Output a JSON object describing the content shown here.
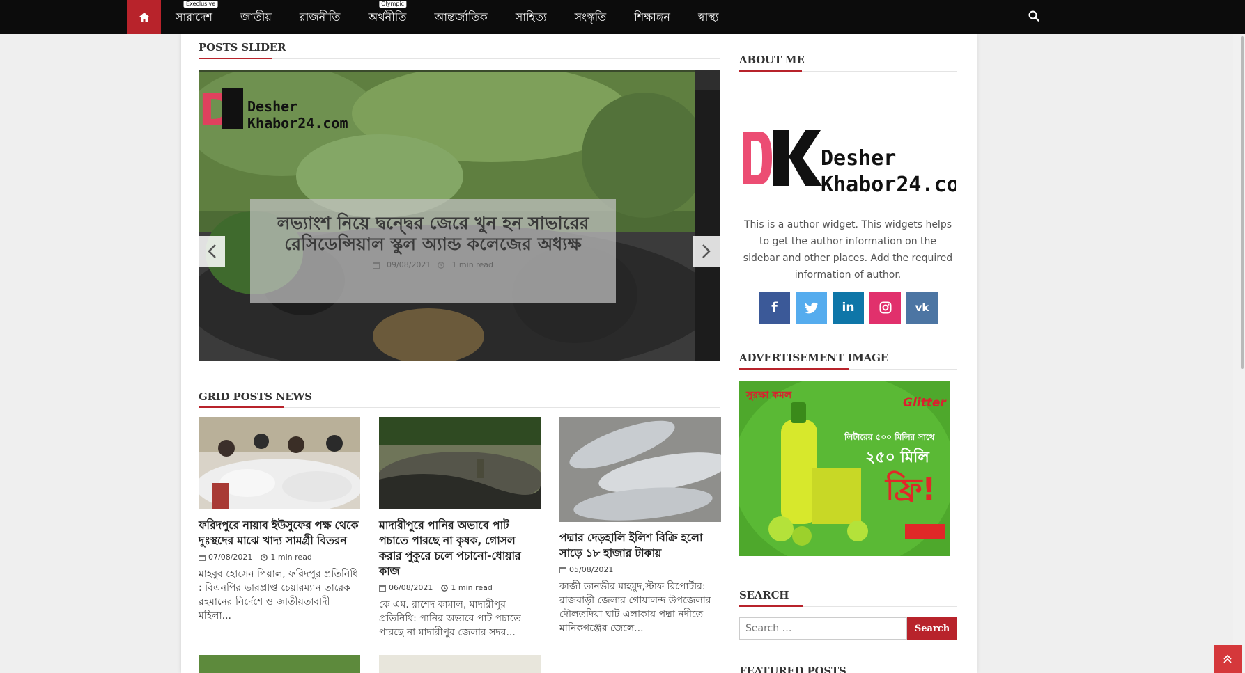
{
  "nav": {
    "home_icon": "home-icon",
    "items": [
      {
        "label": "সারাদেশ",
        "tag": "Execlusive"
      },
      {
        "label": "জাতীয়",
        "tag": ""
      },
      {
        "label": "রাজনীতি",
        "tag": ""
      },
      {
        "label": "অর্থনীতি",
        "tag": "Olympic"
      },
      {
        "label": "আন্তর্জাতিক",
        "tag": ""
      },
      {
        "label": "সাহিত্য",
        "tag": ""
      },
      {
        "label": "সংস্কৃতি",
        "tag": ""
      },
      {
        "label": "শিক্ষাঙ্গন",
        "tag": ""
      },
      {
        "label": "স্বাস্থ্য",
        "tag": ""
      }
    ],
    "search_icon": "search-icon",
    "accent": "#b8232b"
  },
  "slider": {
    "section_title": "POSTS SLIDER",
    "logo_text_top": "Desher",
    "logo_text_bottom": "Khabor24.com",
    "logo_letters": "DK",
    "headline": "লভ্যাংশ নিয়ে দ্বন্দ্বের জেরে খুন হন সাভারের রেসিডেন্সিয়াল স্কুল অ্যান্ড কলেজের অধ্যক্ষ",
    "date": "09/08/2021",
    "read_time": "1 min read"
  },
  "grid": {
    "section_title": "GRID POSTS NEWS",
    "posts": [
      {
        "title": "ফরিদপুরে নায়াব ইউসুফের পক্ষ থেকে দুঃস্থদের মাঝে খাদ্য সামগ্রী বিতরন",
        "date": "07/08/2021",
        "read_time": "1 min read",
        "excerpt": "মাহবুব হোসেন পিয়াল, ফরিদপুর প্রতিনিধি : বিএনপির ভারপ্রাপ্ত চেয়ারম্যান তারেক রহমানের নির্দেশে ও জাতীয়তাবাদী মহিলা..."
      },
      {
        "title": "মাদারীপুরে পানির অভাবে পাট পচাতে পারছে না কৃষক, গোসল করার পুকুরে চলে পচানো-ধোয়ার কাজ",
        "date": "06/08/2021",
        "read_time": "1 min read",
        "excerpt": "কে এম. রাশেদ কামাল, মাদারীপুর প্রতিনিধি: পানির অভাবে পাট পচাতে পারছে না মাদারীপুর জেলার সদর..."
      },
      {
        "title": "পদ্মার দেড়হালি ইলিশ বিক্রি হলো সাড়ে ১৮ হাজার টাকায়",
        "date": "05/08/2021",
        "read_time": "",
        "excerpt": "কাজী তানভীর মাহমুদ,স্টাফ রিপোর্টার: রাজবাড়ী জেলার গোয়ালন্দ উপজেলার দৌলতদিয়া ঘাট এলাকায় পদ্মা নদীতে মানিকগঞ্জের জেলে..."
      }
    ]
  },
  "sidebar": {
    "about_title": "ABOUT ME",
    "about_text": "This is a author widget. This widgets helps to get the author information on the sidebar and other places. Add the required information of author.",
    "socials": [
      {
        "name": "facebook",
        "glyph": "f",
        "color": "#3b5998"
      },
      {
        "name": "twitter",
        "glyph": "t",
        "color": "#55acee"
      },
      {
        "name": "linkedin",
        "glyph": "in",
        "color": "#0e76a8"
      },
      {
        "name": "instagram",
        "glyph": "◎",
        "color": "#e1306c"
      },
      {
        "name": "vk",
        "glyph": "vk",
        "color": "#4c75a3"
      }
    ],
    "ad_title": "ADVERTISEMENT IMAGE",
    "ad": {
      "brand": "Glitter",
      "offer_line1": "লিটারের ৫০০ মিলির সাথে",
      "offer_line2": "২৫০ মিলি",
      "offer_line3": "ফ্রি!",
      "corner": "সুরক্ষা কমল"
    },
    "search_title": "SEARCH",
    "search_placeholder": "Search …",
    "search_button": "Search",
    "featured_title": "FEATURED POSTS"
  }
}
